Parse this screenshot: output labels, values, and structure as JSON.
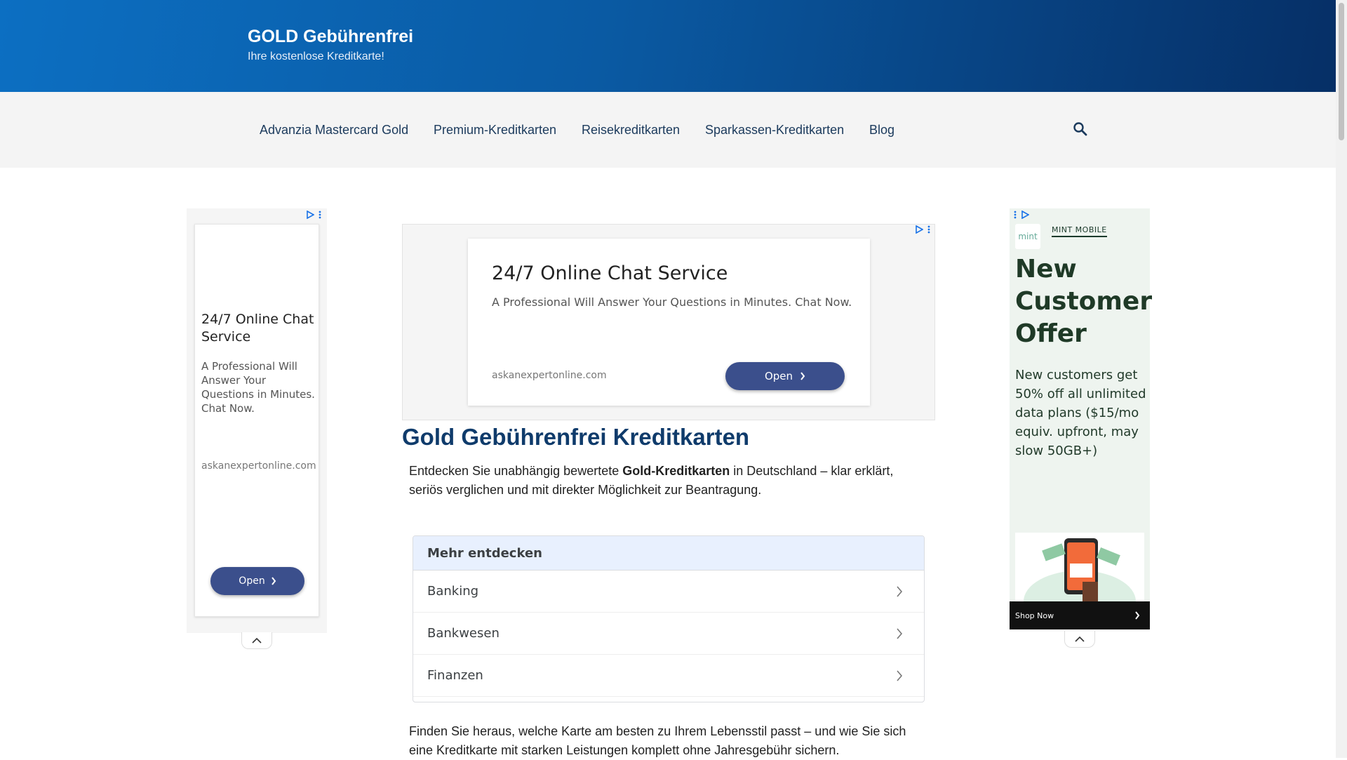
{
  "header": {
    "site_title": "GOLD Gebührenfrei",
    "tagline": "Ihre kostenlose Kreditkarte!"
  },
  "nav": {
    "items": [
      {
        "label": "Advanzia Mastercard Gold"
      },
      {
        "label": "Premium-Kreditkarten"
      },
      {
        "label": "Reisekreditkarten"
      },
      {
        "label": "Sparkassen-Kreditkarten"
      },
      {
        "label": "Blog"
      }
    ],
    "search_icon": "search-icon"
  },
  "ad_left": {
    "title": "24/7 Online Chat Service",
    "description": "A Professional Will Answer Your Questions in Minutes. Chat Now.",
    "domain": "askanexpertonline.com",
    "button": "Open"
  },
  "ad_center": {
    "title": "24/7 Online Chat Service",
    "description": "A Professional Will Answer Your Questions in Minutes. Chat Now.",
    "domain": "askanexpertonline.com",
    "button": "Open"
  },
  "ad_right": {
    "brand_logo": "mint",
    "brand": "MINT MOBILE",
    "offer_title": "New Customer Offer",
    "offer_text": "New customers get 50% off all unlimited data plans ($15/mo equiv. upfront, may slow 50GB+)",
    "shop_label": "Shop Now"
  },
  "article": {
    "heading": "Gold Gebührenfrei Kreditkarten",
    "intro_before": "Entdecken Sie unabhängig bewertete ",
    "intro_bold": "Gold-Kreditkarten",
    "intro_after": " in Deutschland – klar erklärt, seriös verglichen und mit direkter Möglichkeit zur Beantragung.",
    "discover_title": "Mehr entdecken",
    "discover_items": [
      "Banking",
      "Bankwesen",
      "Finanzen"
    ],
    "outro": "Finden Sie heraus, welche Karte am besten zu Ihrem Lebensstil passt – und wie Sie sich eine Kreditkarte mit starken Leistungen komplett ohne Jahresgebühr sichern."
  },
  "colors": {
    "header_start": "#0c6fc2",
    "header_end": "#062f66",
    "heading": "#0f3b6b",
    "ad_button": "#3b4f8c"
  }
}
